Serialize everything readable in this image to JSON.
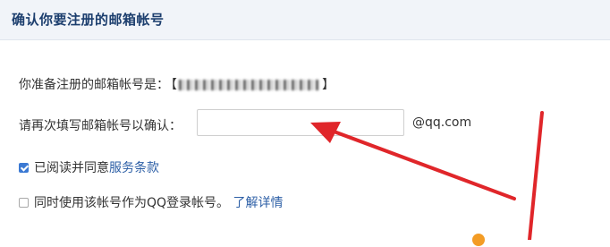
{
  "header": {
    "title": "确认你要注册的邮箱帐号"
  },
  "form": {
    "prepared_label": "你准备注册的邮箱帐号是：",
    "bracket_open": "【",
    "bracket_close": "】",
    "reenter_label": "请再次填写邮箱帐号以确认：",
    "email_input_value": "",
    "email_suffix": "@qq.com",
    "agree_checked": true,
    "agree_text": "已阅读并同意",
    "agree_link": "服务条款",
    "qq_login_checked": false,
    "qq_login_text": "同时使用该帐号作为QQ登录帐号。",
    "qq_login_link": "了解详情"
  },
  "colors": {
    "header_bg": "#f1f4f9",
    "header_title": "#1c3e6e",
    "link": "#2d5fa6",
    "arrow": "#e0262a",
    "checkbox_checked": "#3b79d3"
  },
  "icons": {
    "arrow": "red-annotation-arrow-icon",
    "checkbox": "checkbox-icon"
  }
}
